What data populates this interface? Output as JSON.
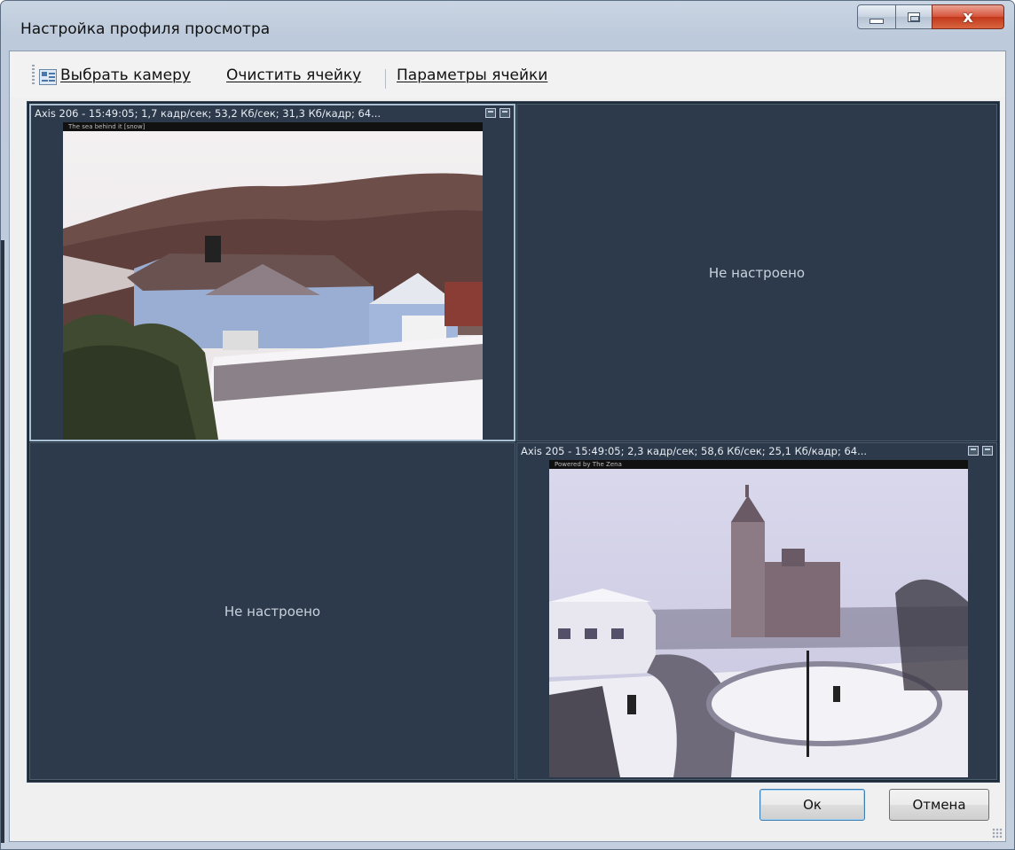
{
  "window": {
    "title": "Настройка профиля просмотра",
    "controls": {
      "minimize": "minimize",
      "maximize": "maximize",
      "close": "x"
    }
  },
  "toolbar": {
    "select_camera": "Выбрать камеру",
    "clear_cell": "Очистить ячейку",
    "cell_params": "Параметры ячейки"
  },
  "cells": [
    {
      "caption": "Axis 206 - 15:49:05; 1,7 кадр/сек; 53,2 Кб/сек; 31,3 Кб/кадр; 64...",
      "feed_banner": "The sea behind it [snow]",
      "status": "",
      "selected": true
    },
    {
      "caption": "",
      "status": "Не настроено",
      "selected": false
    },
    {
      "caption": "",
      "status": "Не настроено",
      "selected": false
    },
    {
      "caption": "Axis 205 - 15:49:05; 2,3 кадр/сек; 58,6 Кб/сек; 25,1 Кб/кадр; 64...",
      "feed_banner": "Powered by The Zena",
      "status": "",
      "selected": false
    }
  ],
  "buttons": {
    "ok": "Ок",
    "cancel": "Отмена"
  },
  "colors": {
    "cell_bg": "#2d3a4b",
    "grid_bg": "#1e2a36",
    "selected_border": "#a9bfd4",
    "close_button": "#c2381c"
  }
}
